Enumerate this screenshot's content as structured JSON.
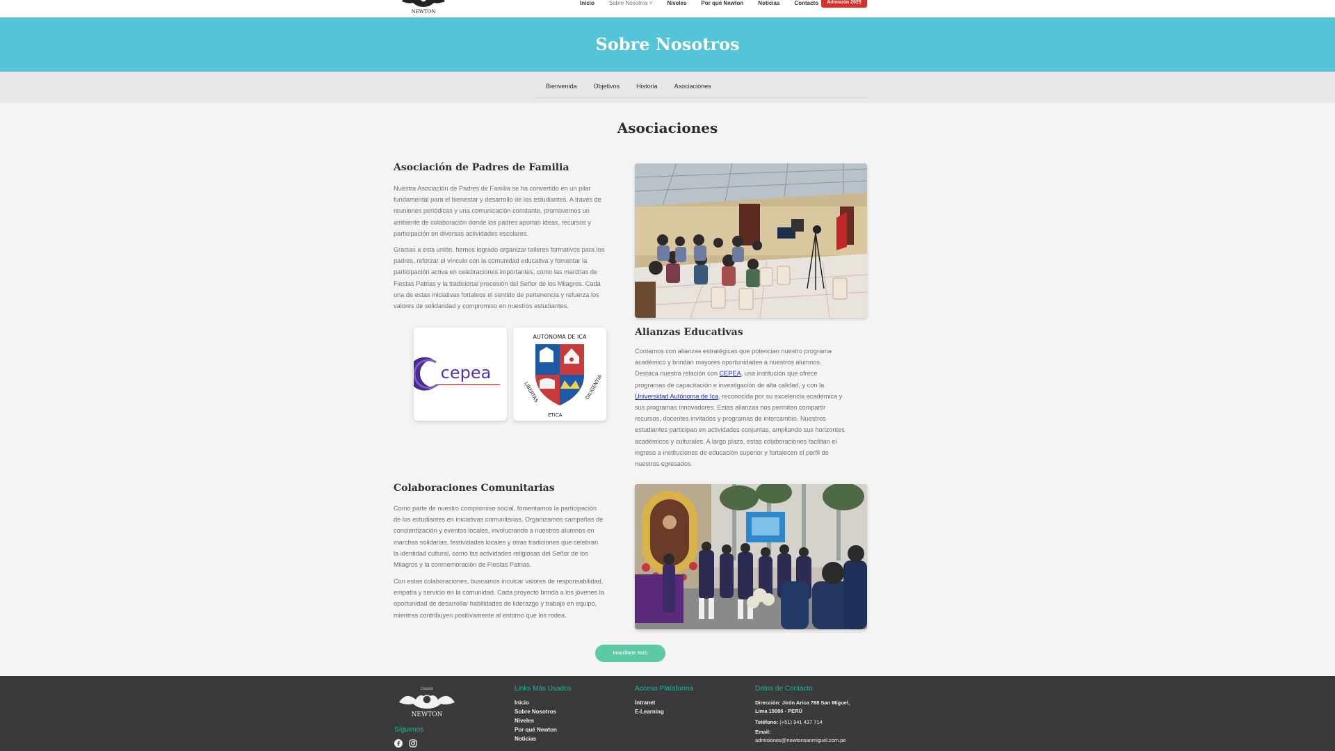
{
  "nav": {
    "logo_text": "NEWTON",
    "items": [
      "Inicio",
      "Sobre Nosotros ˅",
      "Niveles",
      "Por qué Newton",
      "Noticias",
      "Contacto"
    ],
    "admission": "Admisión 2025"
  },
  "hero": {
    "title": "Sobre Nosotros"
  },
  "subnav": {
    "tabs": [
      "Bienvenida",
      "Objetivos",
      "Historia",
      "Asociaciones"
    ]
  },
  "main": {
    "title": "Asociaciones",
    "padres": {
      "heading": "Asociación de Padres de Familia",
      "p1": [
        "Nuestra Asociación de Padres de Familia se ha convertido en un pilar",
        "fundamental para el bienestar y desarrollo de los estudiantes. A través de",
        "reuniones periódicas y una comunicación constante, promovemos un",
        "ambiente de colaboración donde los padres aportan ideas, recursos y",
        "participación en diversas actividades escolares."
      ],
      "p2": [
        "Gracias a esta unión, hemos logrado organizar talleres formativos para los",
        "padres, reforzar el vínculo con la comunidad educativa y fomentar la",
        "participación activa en celebraciones importantes, como las marchas de",
        "Fiestas Patrias y la tradicional procesión del Señor de los Milagros. Cada",
        "una de estas iniciativas fortalece el sentido de pertenencia y refuerza los",
        "valores de solidaridad y compromiso en nuestros estudiantes."
      ]
    },
    "logos": {
      "cepea": "cepea",
      "uaica_arc": "AUTÓNOMA DE ICA",
      "uaica_motto": "LIBERTAS ETICA DILIGENTIA"
    },
    "alianzas": {
      "heading": "Alianzas Educativas",
      "line1": "Contamos con alianzas estratégicas que potencian nuestro programa",
      "line2": "académico y brindan mayores oportunidades a nuestros alumnos.",
      "line3_pre": "Destaca nuestra relación con ",
      "link1": "CEPEA",
      "line3_post": ", una institución que ofrece",
      "line4": "programas de capacitación e investigación de alta calidad, y con la",
      "link2": "Universidad Autónoma de Ica",
      "line5_post": ", reconocida por su excelencia académica y",
      "rest": [
        "sus programas innovadores. Estas alianzas nos permiten compartir",
        "recursos, docentes invitados y programas de intercambio. Nuestros",
        "estudiantes participan en actividades conjuntas, ampliando sus horizontes",
        "académicos y culturales. A largo plazo, estas colaboraciones facilitan el",
        "ingreso a instituciones de educación superior y fortalecen el perfil de",
        "nuestros egresados."
      ]
    },
    "comunidad": {
      "heading": "Colaboraciones Comunitarias",
      "p1": [
        "Como parte de nuestro compromiso social, fomentamos la participación",
        "de los estudiantes en iniciativas comunitarias. Organizamos campañas de",
        "concientización y eventos locales, involucrando a nuestros alumnos en",
        "marchas solidarias, festividades locales y otras tradiciones que celebran",
        "la identidad cultural, como las actividades religiosas del Señor de los",
        "Milagros y la conmemoración de Fiestas Patrias."
      ],
      "p2": [
        "Con estas colaboraciones, buscamos inculcar valores de responsabilidad,",
        "empatía y servicio en la comunidad. Cada proyecto brinda a los jóvenes la",
        "oportunidad de desarrollar habilidades de liderazgo y trabajo en equipo,",
        "mientras contribuyen positivamente al entorno que los rodea."
      ]
    },
    "cta": "Inscríbete Ya!!!"
  },
  "footer": {
    "logo_top": "COLEGIO",
    "logo_text": "NEWTON",
    "follow": "Síguenos",
    "links_title": "Links Más Usados",
    "links": [
      "Inicio",
      "Sobre Nosotros",
      "Niveles",
      "Por qué Newton",
      "Noticias"
    ],
    "platform_title": "Acceso Plataforma",
    "platform": [
      "Intranet",
      "E-Learning"
    ],
    "contact_title": "Datos de Contacto",
    "address_label": "Dirección:",
    "address_1": " Jirón Arica 788 San Miguel,",
    "address_2": "Lima 15086 - PERÚ",
    "phone_label": "Teléfono:",
    "phone": " (+51) 941 437 714",
    "email_label": "Email:",
    "email": "admisiones@newtonsanmiguel.com.pe"
  },
  "colors": {
    "hero": "#54c4d9",
    "accent": "#19b6a1",
    "admission": "#d9302e",
    "cta": "#5cc9a7",
    "footer": "#3a3a3c"
  }
}
